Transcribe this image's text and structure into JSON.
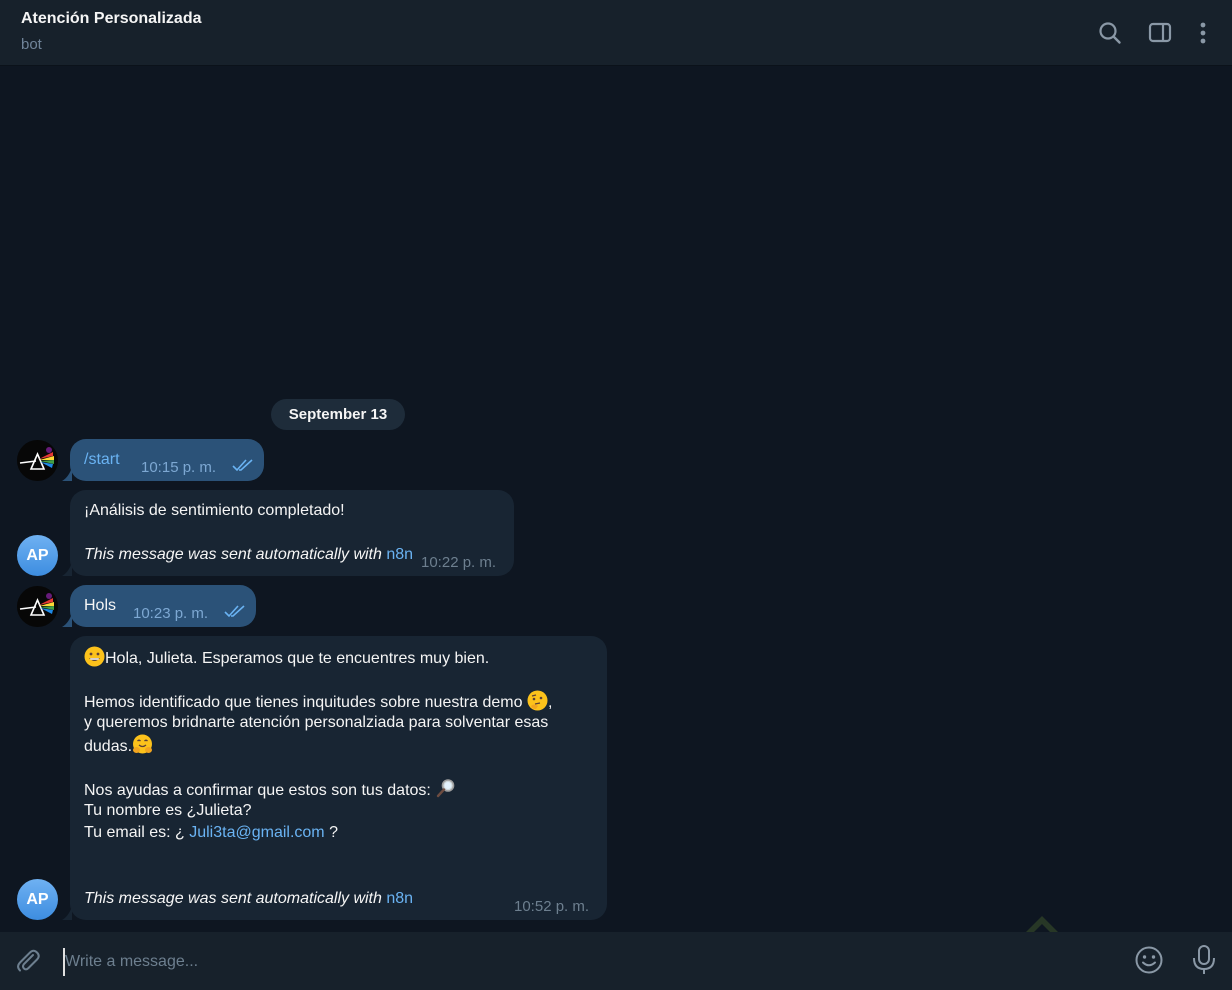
{
  "header": {
    "title": "Atención Personalizada",
    "subtitle": "bot",
    "icons": [
      "search-icon",
      "sidebar-toggle-icon",
      "more-vertical-icon"
    ]
  },
  "chat": {
    "date": "September 13",
    "messages": [
      {
        "side": "out",
        "text": "/start",
        "time": "10:15 p. m.",
        "status": "read"
      },
      {
        "side": "in",
        "sender_initials": "AP",
        "text": "¡Análisis de sentimiento completado!",
        "footer_text": "This message was sent automatically with",
        "footer_link": "n8n",
        "time": "10:22 p. m."
      },
      {
        "side": "out",
        "text": "Hols",
        "time": "10:23 p. m.",
        "status": "read"
      },
      {
        "side": "in",
        "sender_initials": "AP",
        "line1": "Hola,  Julieta. Esperamos que te encuentres muy bien.",
        "line2a": "Hemos identificado que tienes inquitudes sobre nuestra demo",
        "line2b": "y queremos bridnarte atención personalziada para solventar esas",
        "line2c": "dudas.",
        "line3": "Nos ayudas a confirmar que estos son tus datos:",
        "line4": "Tu nombre es ¿Julieta?",
        "line5_prefix": "Tu email es: ¿",
        "line5_email": "Juli3ta@gmail.com",
        "line5_suffix": "?",
        "footer_text": "This message was sent automatically with",
        "footer_link": "n8n",
        "time": "10:52 p. m.",
        "emojis": [
          "grinning-emoji",
          "thinking-emoji",
          "hugging-emoji",
          "magnifier-emoji"
        ]
      }
    ]
  },
  "composer": {
    "placeholder": "Write a message...",
    "icons": [
      "attach-icon",
      "emoji-icon",
      "microphone-icon"
    ]
  },
  "colors": {
    "background": "#0e1621",
    "header": "#17212b",
    "incoming_bubble": "#182533",
    "outgoing_bubble": "#2b5278",
    "link": "#6ab3f3",
    "avatar": "#4a9ae6"
  }
}
